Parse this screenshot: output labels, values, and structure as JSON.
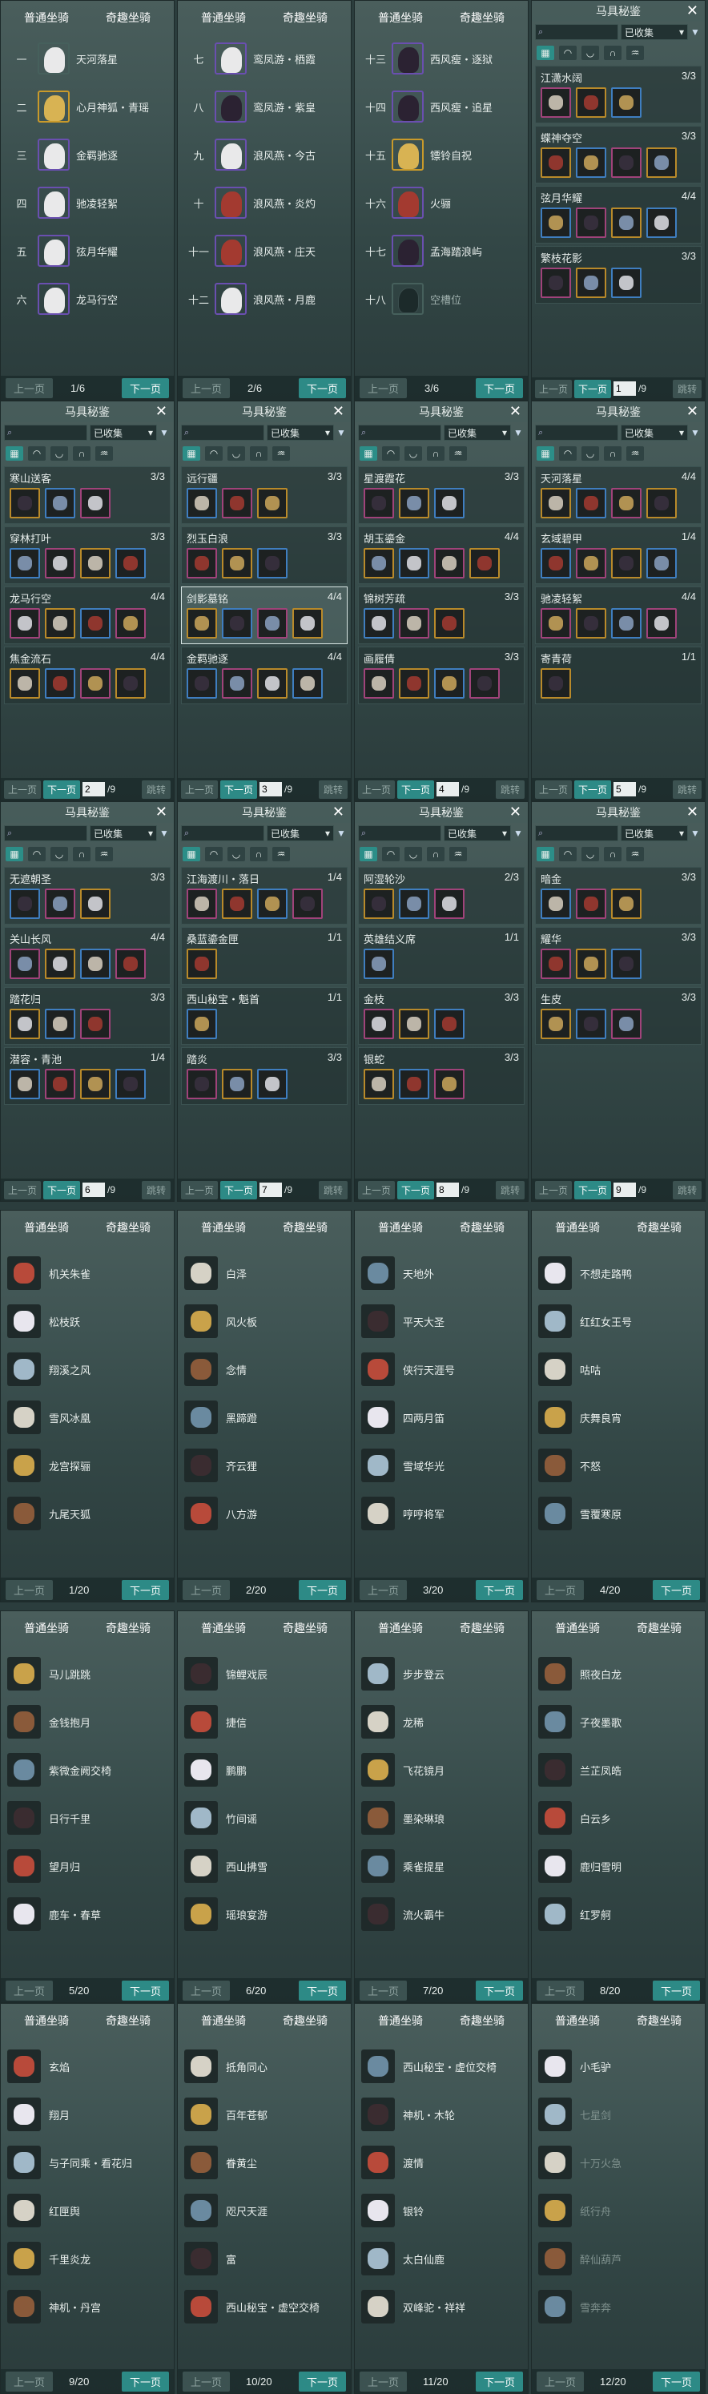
{
  "tabs": {
    "normal": "普通坐骑",
    "fun": "奇趣坐骑"
  },
  "pager": {
    "prev": "上一页",
    "next": "下一页",
    "jump": "跳转"
  },
  "secret": {
    "title": "马具秘鉴",
    "filter": "已收集",
    "close": "✕"
  },
  "list_pages": [
    {
      "page": "1/6",
      "rows": [
        {
          "num": "一",
          "name": "天河落星"
        },
        {
          "num": "二",
          "name": "心月神狐・青瑶"
        },
        {
          "num": "三",
          "name": "金羁驰逐"
        },
        {
          "num": "四",
          "name": "驰凌轻絮"
        },
        {
          "num": "五",
          "name": "弦月华耀"
        },
        {
          "num": "六",
          "name": "龙马行空"
        }
      ]
    },
    {
      "page": "2/6",
      "rows": [
        {
          "num": "七",
          "name": "鸾凤游・栖霞"
        },
        {
          "num": "八",
          "name": "鸾凤游・紫皇"
        },
        {
          "num": "九",
          "name": "浪风燕・今古"
        },
        {
          "num": "十",
          "name": "浪风燕・炎灼"
        },
        {
          "num": "十一",
          "name": "浪风燕・庄天"
        },
        {
          "num": "十二",
          "name": "浪风燕・月鹿"
        }
      ]
    },
    {
      "page": "3/6",
      "rows": [
        {
          "num": "十三",
          "name": "西风瘦・逐狱"
        },
        {
          "num": "十四",
          "name": "西风瘦・追星"
        },
        {
          "num": "十五",
          "name": "镖铃自祝"
        },
        {
          "num": "十六",
          "name": "火骊"
        },
        {
          "num": "十七",
          "name": "孟海踏浪屿"
        },
        {
          "num": "十八",
          "name": "空槽位"
        }
      ]
    }
  ],
  "secret_pages": [
    {
      "page": "1",
      "total": "/9",
      "groups": [
        {
          "name": "江潇水阔",
          "count": "3/3"
        },
        {
          "name": "蝶神夺空",
          "count": "3/3"
        },
        {
          "name": "弦月华耀",
          "count": "4/4"
        },
        {
          "name": "繁枝花影",
          "count": "3/3"
        }
      ]
    },
    {
      "page": "2",
      "total": "/9",
      "groups": [
        {
          "name": "寒山送客",
          "count": "3/3"
        },
        {
          "name": "穿林打叶",
          "count": "3/3"
        },
        {
          "name": "龙马行空",
          "count": "4/4"
        },
        {
          "name": "焦金流石",
          "count": "4/4"
        }
      ]
    },
    {
      "page": "3",
      "total": "/9",
      "groups": [
        {
          "name": "远行疆",
          "count": "3/3"
        },
        {
          "name": "烈玉白浪",
          "count": "3/3"
        },
        {
          "name": "剑影墓铭",
          "count": "4/4"
        },
        {
          "name": "金羁驰逐",
          "count": "4/4"
        }
      ]
    },
    {
      "page": "4",
      "total": "/9",
      "groups": [
        {
          "name": "星渡霞花",
          "count": "3/3"
        },
        {
          "name": "胡玉鎏金",
          "count": "4/4"
        },
        {
          "name": "锦树芳疏",
          "count": "3/3"
        },
        {
          "name": "画履倩",
          "count": "3/3"
        }
      ]
    },
    {
      "page": "5",
      "total": "/9",
      "groups": [
        {
          "name": "天河落星",
          "count": "4/4"
        },
        {
          "name": "玄域碧甲",
          "count": "1/4"
        },
        {
          "name": "驰凌轻絮",
          "count": "4/4"
        },
        {
          "name": "寄青荷",
          "count": "1/1"
        }
      ]
    },
    {
      "page": "6",
      "total": "/9",
      "groups": [
        {
          "name": "无遮朝圣",
          "count": "3/3"
        },
        {
          "name": "关山长风",
          "count": "4/4"
        },
        {
          "name": "踏花归",
          "count": "3/3"
        },
        {
          "name": "潜容・青池",
          "count": "1/4"
        }
      ]
    },
    {
      "page": "7",
      "total": "/9",
      "groups": [
        {
          "name": "江海渡川・落日",
          "count": "1/4"
        },
        {
          "name": "桑蓝鎏金匣",
          "count": "1/1"
        },
        {
          "name": "西山秘宝・魁首",
          "count": "1/1"
        },
        {
          "name": "踏炎",
          "count": "3/3"
        }
      ]
    },
    {
      "page": "8",
      "total": "/9",
      "groups": [
        {
          "name": "阿湿轮沙",
          "count": "2/3"
        },
        {
          "name": "英雄结义席",
          "count": "1/1"
        },
        {
          "name": "金枝",
          "count": "3/3"
        },
        {
          "name": "银蛇",
          "count": "3/3"
        }
      ]
    },
    {
      "page": "9",
      "total": "/9",
      "groups": [
        {
          "name": "暗金",
          "count": "3/3"
        },
        {
          "name": "耀华",
          "count": "3/3"
        },
        {
          "name": "生皮",
          "count": "3/3"
        }
      ]
    }
  ],
  "fun_pages": [
    {
      "page": "1/20",
      "items": [
        "机关朱雀",
        "松枝跃",
        "翔溪之风",
        "雪风冰凰",
        "龙宫探骊",
        "九尾天狐"
      ]
    },
    {
      "page": "2/20",
      "items": [
        "白泽",
        "风火板",
        "念情",
        "黑蹄蹬",
        "齐云狸",
        "八方游"
      ]
    },
    {
      "page": "3/20",
      "items": [
        "天地外",
        "平天大圣",
        "侠行天涯号",
        "四两月笛",
        "雪域华光",
        "哼哼将军"
      ]
    },
    {
      "page": "4/20",
      "items": [
        "不想走路鸭",
        "红红女王号",
        "咕咕",
        "庆舞良宵",
        "不怒",
        "雪覆寒原"
      ]
    },
    {
      "page": "5/20",
      "items": [
        "马儿跳跳",
        "金钱抱月",
        "紫微金阙交椅",
        "日行千里",
        "望月归",
        "鹿车・春草"
      ]
    },
    {
      "page": "6/20",
      "items": [
        "锦鲤戏辰",
        "捷信",
        "鹏鹏",
        "竹间谣",
        "西山拂雪",
        "瑶琅宴游"
      ]
    },
    {
      "page": "7/20",
      "items": [
        "步步登云",
        "龙稀",
        "飞花镜月",
        "墨染琳琅",
        "乘雀提星",
        "流火霸牛"
      ]
    },
    {
      "page": "8/20",
      "items": [
        "照夜白龙",
        "子夜墨歌",
        "兰芷凤皓",
        "白云乡",
        "鹿归雪明",
        "红罗舸"
      ]
    },
    {
      "page": "9/20",
      "items": [
        "玄焰",
        "翔月",
        "与子同乘・看花归",
        "红匣舆",
        "千里炎龙",
        "神机・丹宫"
      ]
    },
    {
      "page": "10/20",
      "items": [
        "抵角同心",
        "百年苍郁",
        "眷黄尘",
        "咫尺天涯",
        "富",
        "西山秘宝・虚空交椅"
      ]
    },
    {
      "page": "11/20",
      "items": [
        "西山秘宝・虚位交椅",
        "神机・木轮",
        "渡情",
        "银铃",
        "太白仙鹿",
        "双峰驼・祥祥"
      ]
    },
    {
      "page": "12/20",
      "items": [
        "小毛驴",
        "七星剑",
        "十万火急",
        "纸行舟",
        "醉仙葫芦",
        "雪奔奔"
      ]
    }
  ]
}
